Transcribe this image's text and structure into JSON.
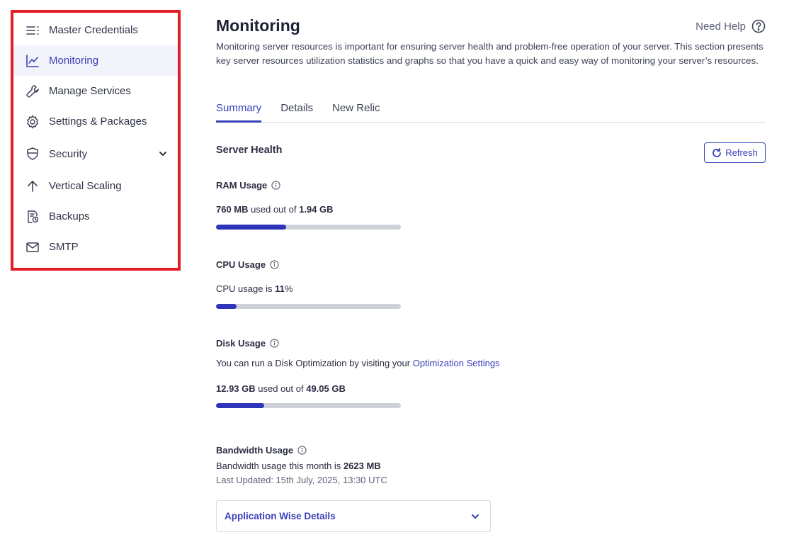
{
  "sidebar": {
    "items": [
      {
        "label": "Master Credentials",
        "icon": "menu-list-icon"
      },
      {
        "label": "Monitoring",
        "icon": "chart-line-icon"
      },
      {
        "label": "Manage Services",
        "icon": "wrench-icon"
      },
      {
        "label": "Settings & Packages",
        "icon": "gear-icon"
      },
      {
        "label": "Security",
        "icon": "shield-icon"
      },
      {
        "label": "Vertical Scaling",
        "icon": "arrow-up-icon"
      },
      {
        "label": "Backups",
        "icon": "backup-icon"
      },
      {
        "label": "SMTP",
        "icon": "mail-icon"
      }
    ]
  },
  "header": {
    "title": "Monitoring",
    "help_label": "Need Help",
    "intro": "Monitoring server resources is important for ensuring server health and problem-free operation of your server. This section presents key server resources utilization statistics and graphs so that you have a quick and easy way of monitoring your server’s resources."
  },
  "tabs": [
    {
      "label": "Summary",
      "active": true
    },
    {
      "label": "Details",
      "active": false
    },
    {
      "label": "New Relic",
      "active": false
    }
  ],
  "server_health": {
    "title": "Server Health",
    "refresh_label": "Refresh",
    "ram": {
      "label": "RAM Usage",
      "used": "760 MB",
      "mid": " used out of ",
      "total": "1.94 GB",
      "fraction": 0.38
    },
    "cpu": {
      "label": "CPU Usage",
      "prefix": "CPU usage is ",
      "value": "11",
      "suffix": "%",
      "fraction": 0.11
    },
    "disk": {
      "label": "Disk Usage",
      "hint_prefix": "You can run a Disk Optimization by visiting your ",
      "hint_link": "Optimization Settings",
      "used": "12.93 GB",
      "mid": " used out of ",
      "total": "49.05 GB",
      "fraction": 0.26
    },
    "bandwidth": {
      "label": "Bandwidth Usage",
      "prefix": "Bandwidth usage this month is ",
      "value": "2623 MB",
      "last_updated": "Last Updated: 15th July, 2025, 13:30 UTC"
    },
    "accordion_label": "Application Wise Details"
  },
  "colors": {
    "accent": "#3a41b8",
    "bar_fill": "#2f35b8",
    "bar_track": "#cfd1d8",
    "highlight_border": "#e21d26"
  }
}
